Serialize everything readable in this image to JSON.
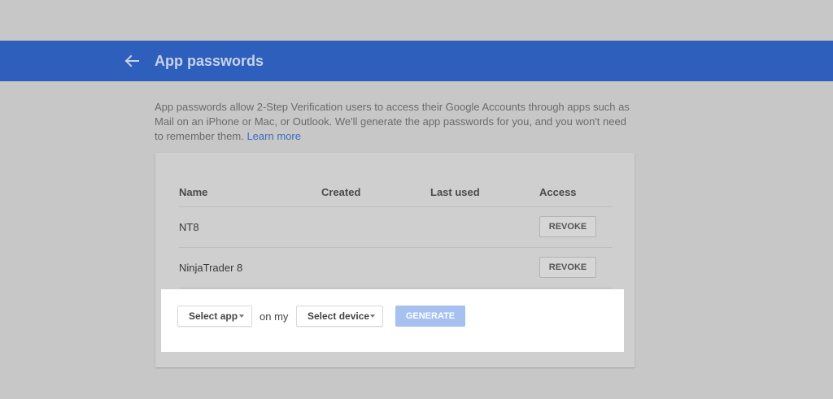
{
  "header": {
    "back_icon": "arrow-left-icon",
    "title": "App passwords",
    "background_color": "#2e5fbd"
  },
  "intro": {
    "text": "App passwords allow 2-Step Verification users to access their Google Accounts through apps such as Mail on an iPhone or Mac, or Outlook. We'll generate the app passwords for you, and you won't need to remember them.",
    "learn_more_label": "Learn more",
    "link_color": "#3f6cc0"
  },
  "table": {
    "columns": {
      "name": "Name",
      "created": "Created",
      "last_used": "Last used",
      "access": "Access"
    },
    "rows": [
      {
        "name": "NT8",
        "created": "",
        "last_used": "",
        "action_label": "REVOKE"
      },
      {
        "name": "NinjaTrader 8",
        "created": "",
        "last_used": "",
        "action_label": "REVOKE"
      }
    ]
  },
  "generator": {
    "select_app_label": "Select app",
    "connector_text": "on my",
    "select_device_label": "Select device",
    "generate_label": "GENERATE",
    "dropdown_icon": "caret-down-icon",
    "generate_color": "#a6c0ef"
  }
}
